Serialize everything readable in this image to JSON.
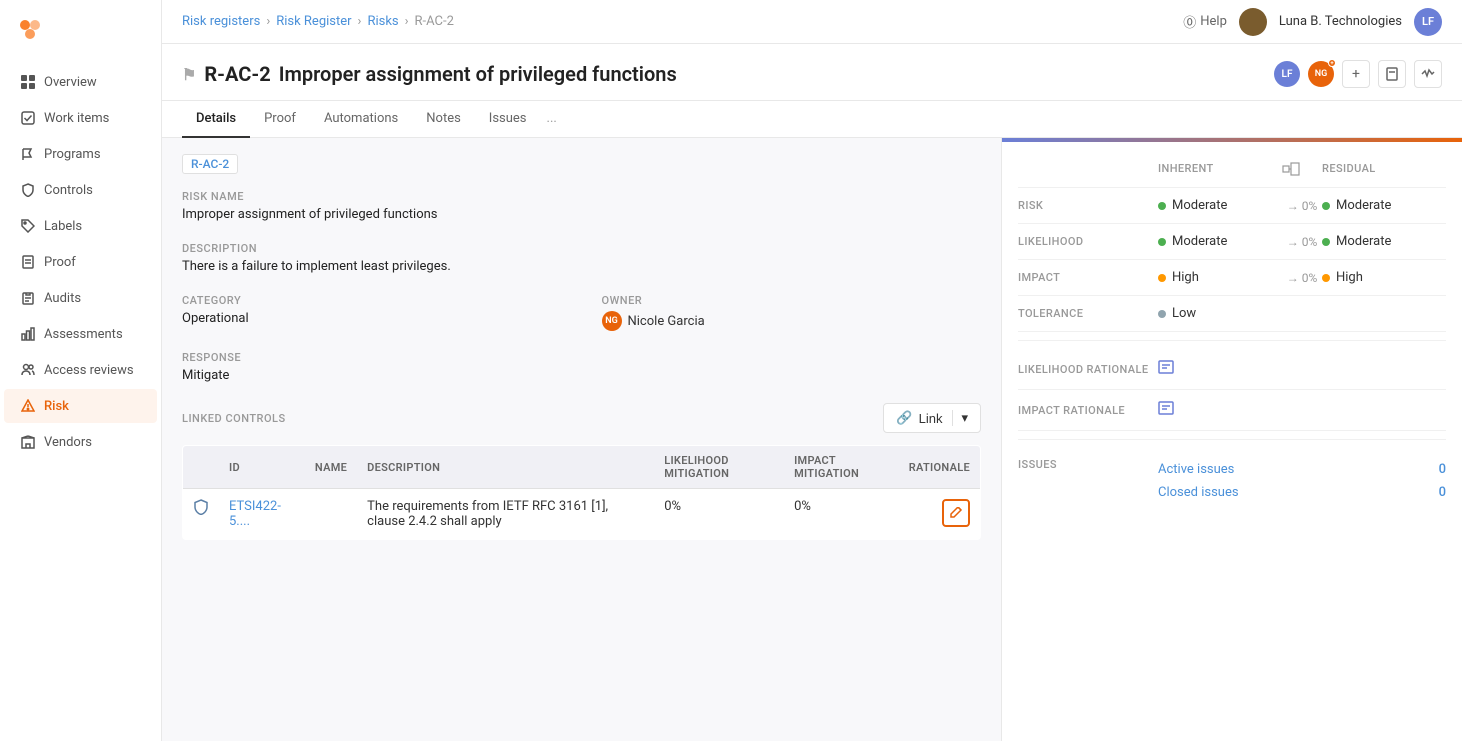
{
  "sidebar": {
    "logo_symbol": "⬡",
    "items": [
      {
        "id": "overview",
        "label": "Overview",
        "icon": "grid-icon",
        "active": false
      },
      {
        "id": "work-items",
        "label": "Work items",
        "icon": "check-square-icon",
        "active": false
      },
      {
        "id": "programs",
        "label": "Programs",
        "icon": "flag-icon",
        "active": false
      },
      {
        "id": "controls",
        "label": "Controls",
        "icon": "shield-icon",
        "active": false
      },
      {
        "id": "labels",
        "label": "Labels",
        "icon": "tag-icon",
        "active": false
      },
      {
        "id": "proof",
        "label": "Proof",
        "icon": "file-icon",
        "active": false
      },
      {
        "id": "audits",
        "label": "Audits",
        "icon": "clipboard-icon",
        "active": false
      },
      {
        "id": "assessments",
        "label": "Assessments",
        "icon": "chart-icon",
        "active": false
      },
      {
        "id": "access-reviews",
        "label": "Access reviews",
        "icon": "users-icon",
        "active": false
      },
      {
        "id": "risk",
        "label": "Risk",
        "icon": "alert-icon",
        "active": true
      },
      {
        "id": "vendors",
        "label": "Vendors",
        "icon": "building-icon",
        "active": false
      }
    ],
    "collapse_label": "«"
  },
  "topnav": {
    "breadcrumb": [
      {
        "label": "Risk registers",
        "link": true
      },
      {
        "label": "Risk Register",
        "link": true
      },
      {
        "label": "Risks",
        "link": true
      },
      {
        "label": "R-AC-2",
        "link": false
      }
    ],
    "help_label": "Help",
    "user_name": "Luna B. Technologies",
    "user_initials": "LF"
  },
  "page": {
    "record_id": "R-AC-2",
    "title": "Improper assignment of privileged functions",
    "title_icon": "flag-icon",
    "avatars": [
      {
        "initials": "LF",
        "color": "#6b7fd7"
      },
      {
        "initials": "NG",
        "color": "#e8630a"
      }
    ]
  },
  "tabs": [
    {
      "id": "details",
      "label": "Details",
      "active": true
    },
    {
      "id": "proof",
      "label": "Proof",
      "active": false
    },
    {
      "id": "automations",
      "label": "Automations",
      "active": false
    },
    {
      "id": "notes",
      "label": "Notes",
      "active": false
    },
    {
      "id": "issues",
      "label": "Issues",
      "active": false
    },
    {
      "id": "more",
      "label": "...",
      "active": false
    }
  ],
  "details": {
    "record_id": "R-AC-2",
    "risk_name_label": "RISK NAME",
    "risk_name_value": "Improper assignment of privileged functions",
    "description_label": "DESCRIPTION",
    "description_value": "There is a failure to implement least privileges.",
    "category_label": "CATEGORY",
    "category_value": "Operational",
    "owner_label": "OWNER",
    "owner_value": "Nicole Garcia",
    "response_label": "RESPONSE",
    "response_value": "Mitigate",
    "linked_controls_label": "LINKED CONTROLS",
    "link_btn_label": "Link"
  },
  "controls_table": {
    "columns": [
      "",
      "ID",
      "NAME",
      "DESCRIPTION",
      "LIKELIHOOD MITIGATION",
      "IMPACT MITIGATION",
      "RATIONALE"
    ],
    "rows": [
      {
        "icon": "shield-icon",
        "id": "ETSI422-5....",
        "name": "",
        "description": "The requirements from IETF RFC 3161 [1], clause 2.4.2 shall apply",
        "likelihood_mitigation": "0%",
        "impact_mitigation": "0%",
        "rationale": ""
      }
    ]
  },
  "risk_panel": {
    "inherent_label": "INHERENT",
    "residual_label": "RESIDUAL",
    "rows": [
      {
        "label": "RISK",
        "inherent_dot": "green",
        "inherent_value": "Moderate",
        "arrow_pct": "→ 0%",
        "residual_dot": "green",
        "residual_value": "Moderate"
      },
      {
        "label": "LIKELIHOOD",
        "inherent_dot": "green",
        "inherent_value": "Moderate",
        "arrow_pct": "→ 0%",
        "residual_dot": "green",
        "residual_value": "Moderate"
      },
      {
        "label": "IMPACT",
        "inherent_dot": "orange",
        "inherent_value": "High",
        "arrow_pct": "→ 0%",
        "residual_dot": "orange",
        "residual_value": "High"
      },
      {
        "label": "TOLERANCE",
        "inherent_dot": "blue",
        "inherent_value": "Low",
        "arrow_pct": "",
        "residual_dot": "",
        "residual_value": ""
      }
    ],
    "rationale_rows": [
      {
        "label": "LIKELIHOOD RATIONALE",
        "has_edit": true
      },
      {
        "label": "IMPACT RATIONALE",
        "has_edit": true
      }
    ],
    "issues": {
      "label": "ISSUES",
      "active_label": "Active issues",
      "active_count": "0",
      "closed_label": "Closed issues",
      "closed_count": "0"
    }
  }
}
